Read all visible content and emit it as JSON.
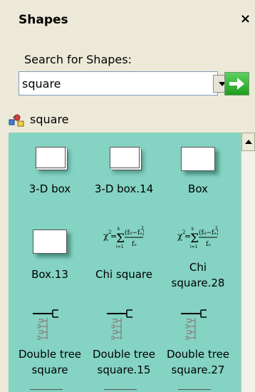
{
  "panel": {
    "title": "Shapes",
    "close_label": "×"
  },
  "search": {
    "label": "Search for Shapes:",
    "value": "square"
  },
  "result": {
    "label": "square"
  },
  "shapes": [
    {
      "label": "3-D box",
      "icon": "3d-box"
    },
    {
      "label": "3-D box.14",
      "icon": "3d-box"
    },
    {
      "label": "Box",
      "icon": "box"
    },
    {
      "label": "Box.13",
      "icon": "box"
    },
    {
      "label": "Chi square",
      "icon": "chi-square-formula"
    },
    {
      "label": "Chi square.28",
      "label_lines": [
        "Chi",
        "square.28"
      ],
      "icon": "chi-square-formula"
    },
    {
      "label": "Double tree square",
      "label_lines": [
        "Double tree",
        "square"
      ],
      "icon": "double-tree"
    },
    {
      "label": "Double tree square.15",
      "label_lines": [
        "Double tree",
        "square.15"
      ],
      "icon": "double-tree"
    },
    {
      "label": "Double tree square.27",
      "label_lines": [
        "Double tree",
        "square.27"
      ],
      "icon": "double-tree"
    }
  ],
  "colors": {
    "stencil_background": "#84d3c3",
    "panel_background": "#ece9d8",
    "go_button": "#2eaf2e"
  }
}
